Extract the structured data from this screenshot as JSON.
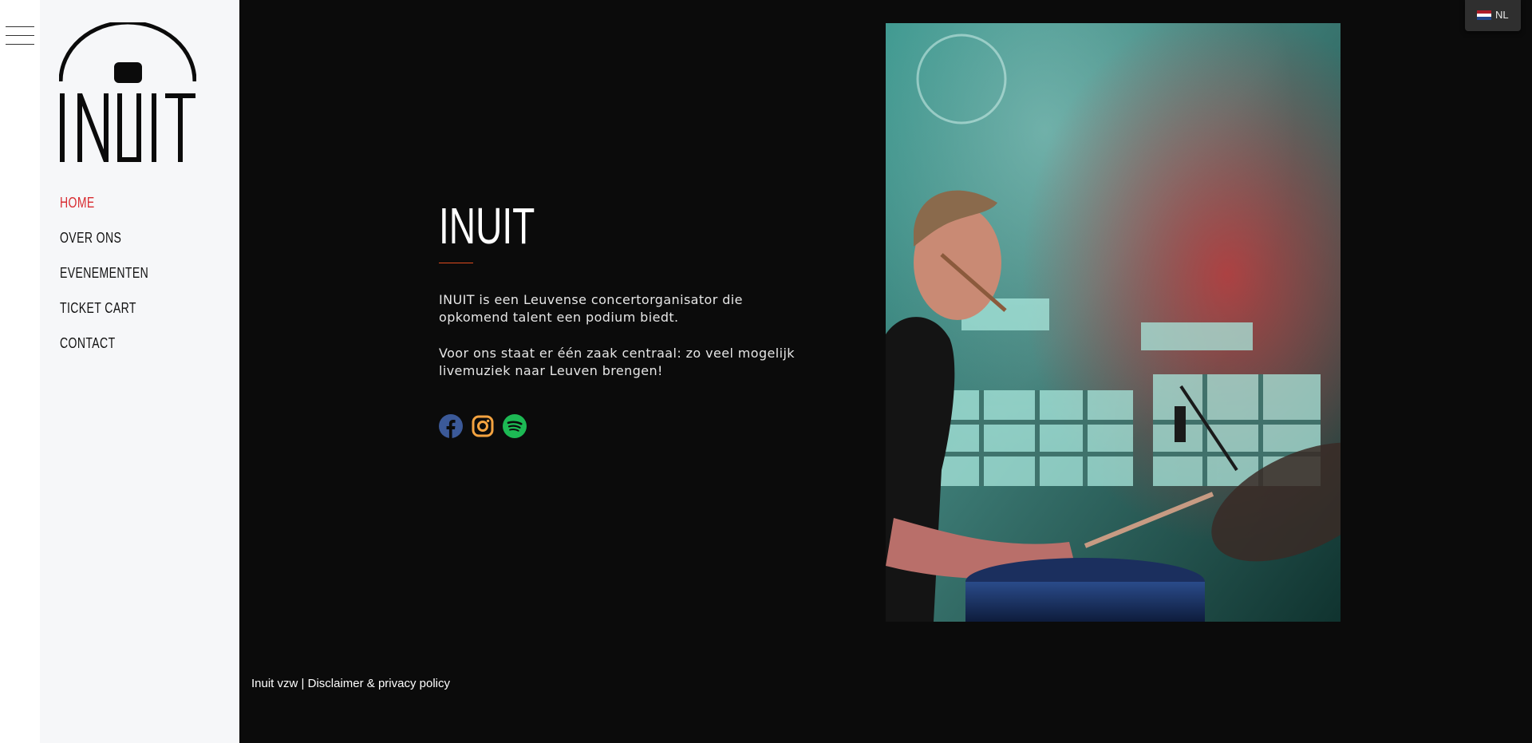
{
  "site": {
    "brand": "INUIT"
  },
  "menu": {
    "hamburger_icon": "hamburger-icon"
  },
  "sidebar": {
    "logo_text": "INUIT",
    "nav": [
      {
        "label": "HOME",
        "active": true
      },
      {
        "label": "OVER ONS",
        "active": false
      },
      {
        "label": "EVENEMENTEN",
        "active": false
      },
      {
        "label": "TICKET CART",
        "active": false
      },
      {
        "label": "CONTACT",
        "active": false
      }
    ]
  },
  "hero": {
    "title": "INUIT",
    "paragraphs": [
      "INUIT is een Leuvense concertorganisator die opkomend talent een podium biedt.",
      "Voor ons staat er één zaak centraal: zo veel mogelijk livemuziek naar Leuven brengen!"
    ],
    "socials": [
      {
        "icon": "facebook-icon",
        "color": "#3b5998"
      },
      {
        "icon": "instagram-icon",
        "color": "#f4a340"
      },
      {
        "icon": "spotify-icon",
        "color": "#1db954"
      }
    ]
  },
  "footer": {
    "org": "Inuit vzw",
    "separator": "|",
    "link": "Disclaimer & privacy policy"
  },
  "language": {
    "code": "NL",
    "flag_icon": "netherlands-flag-icon"
  },
  "colors": {
    "accent": "#d82b30",
    "divider": "#e04a1e",
    "background": "#0b0b0b",
    "sidebar": "#f6f7f9"
  }
}
